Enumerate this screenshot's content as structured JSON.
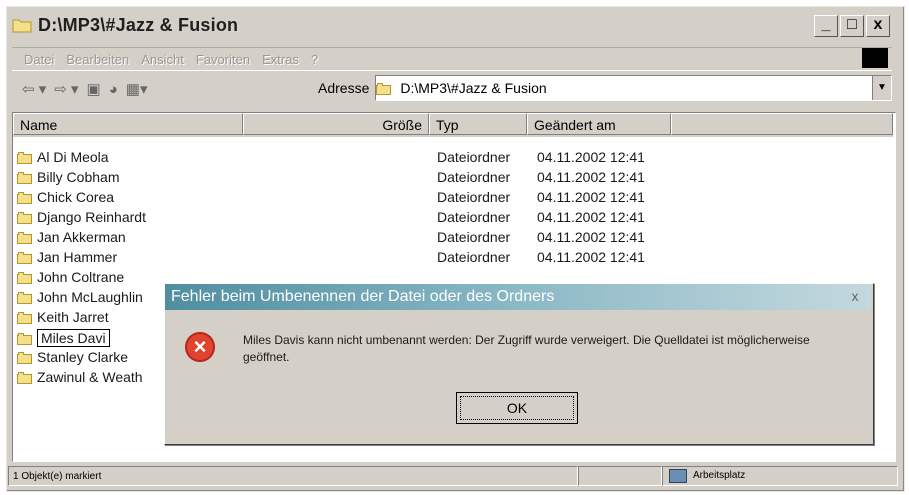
{
  "window": {
    "title": "D:\\MP3\\#Jazz & Fusion",
    "buttons": [
      "_",
      "□",
      "x"
    ]
  },
  "menu": [
    "Datei",
    "Bearbeiten",
    "Ansicht",
    "Favoriten",
    "Extras",
    "?"
  ],
  "address": {
    "label": "Adresse",
    "value": "D:\\MP3\\#Jazz & Fusion"
  },
  "columns": [
    "Name",
    "Größe",
    "Typ",
    "Geändert am"
  ],
  "files": [
    {
      "name": "Al Di Meola",
      "typ": "Dateiordner",
      "date": "04.11.2002 12:41"
    },
    {
      "name": "Billy Cobham",
      "typ": "Dateiordner",
      "date": "04.11.2002 12:41"
    },
    {
      "name": "Chick Corea",
      "typ": "Dateiordner",
      "date": "04.11.2002 12:41"
    },
    {
      "name": "Django Reinhardt",
      "typ": "Dateiordner",
      "date": "04.11.2002 12:41"
    },
    {
      "name": "Jan Akkerman",
      "typ": "Dateiordner",
      "date": "04.11.2002 12:41"
    },
    {
      "name": "Jan Hammer",
      "typ": "Dateiordner",
      "date": "04.11.2002 12:41"
    },
    {
      "name": "John Coltrane",
      "typ": "",
      "date": ""
    },
    {
      "name": "John McLaughlin",
      "typ": "",
      "date": ""
    },
    {
      "name": "Keith Jarret",
      "typ": "",
      "date": ""
    },
    {
      "name": "Miles Davi",
      "typ": "",
      "date": "",
      "renaming": true
    },
    {
      "name": "Stanley Clarke",
      "typ": "",
      "date": ""
    },
    {
      "name": "Zawinul & Weath",
      "typ": "",
      "date": ""
    }
  ],
  "status": {
    "selected": "1 Objekt(e) markiert",
    "location": "Arbeitsplatz"
  },
  "dialog": {
    "title": "Fehler beim Umbenennen der Datei oder des Ordners",
    "close": "x",
    "message": "Miles Davis kann nicht umbenannt werden: Der Zugriff wurde verweigert. Die Quelldatei ist möglicherweise geöffnet.",
    "ok": "OK"
  }
}
